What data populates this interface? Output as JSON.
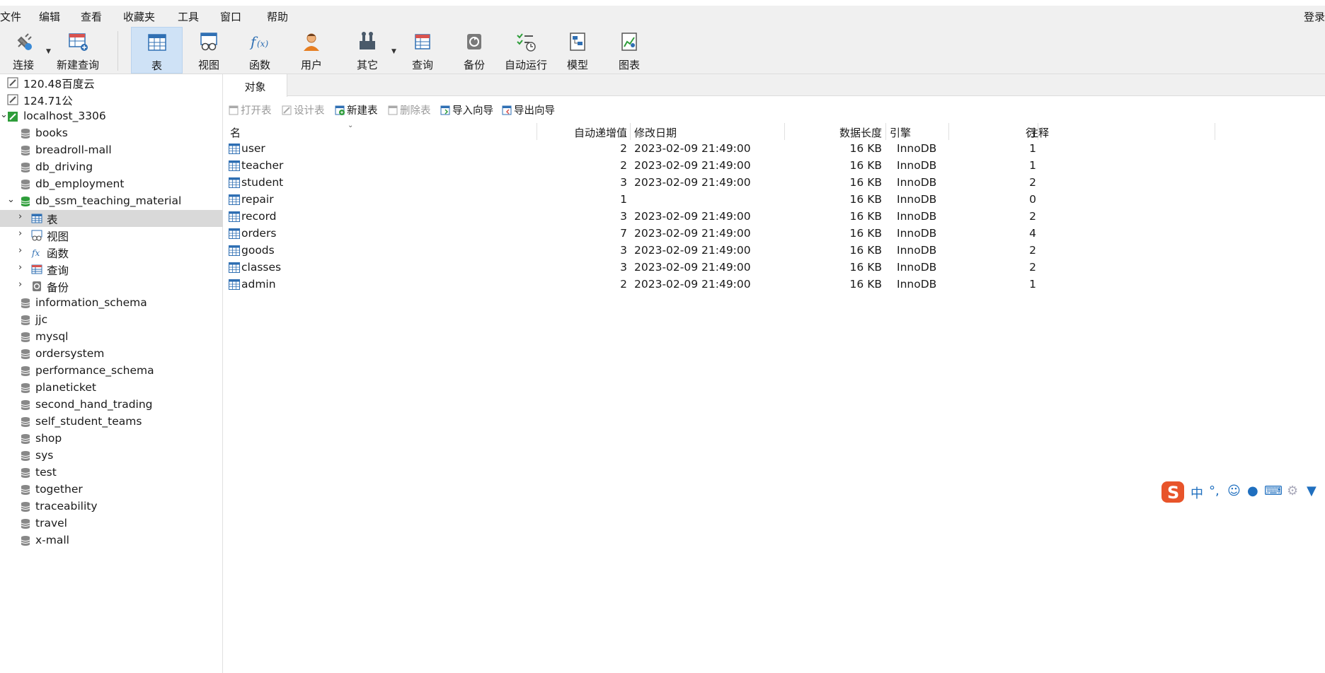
{
  "menu": {
    "items": [
      "文件",
      "编辑",
      "查看",
      "收藏夹",
      "工具",
      "窗口",
      "帮助"
    ],
    "login": "登录"
  },
  "toolbar": {
    "connect": "连接",
    "new_query": "新建查询",
    "table": "表",
    "view": "视图",
    "function": "函数",
    "user": "用户",
    "other": "其它",
    "query": "查询",
    "backup": "备份",
    "automation": "自动运行",
    "model": "模型",
    "chart": "图表"
  },
  "sidebar": {
    "connections": [
      "120.48百度云",
      "124.71公",
      "localhost_3306"
    ],
    "databases_before": [
      "books",
      "breadroll-mall",
      "db_driving",
      "db_employment",
      "db_ssm_teaching_material"
    ],
    "open_db_children": [
      "表",
      "视图",
      "函数",
      "查询",
      "备份"
    ],
    "databases_after": [
      "information_schema",
      "jjc",
      "mysql",
      "ordersystem",
      "performance_schema",
      "planeticket",
      "second_hand_trading",
      "self_student_teams",
      "shop",
      "sys",
      "test",
      "together",
      "traceability",
      "travel",
      "x-mall"
    ]
  },
  "main": {
    "tab": "对象",
    "object_toolbar": {
      "open_table": "打开表",
      "design_table": "设计表",
      "new_table": "新建表",
      "delete_table": "删除表",
      "import_wizard": "导入向导",
      "export_wizard": "导出向导"
    },
    "columns": [
      "名",
      "自动递增值",
      "修改日期",
      "数据长度",
      "引擎",
      "行",
      "注释"
    ],
    "rows": [
      {
        "name": "user",
        "auto_inc": "2",
        "modified": "2023-02-09 21:49:00",
        "size": "16 KB",
        "engine": "InnoDB",
        "rows": "1"
      },
      {
        "name": "teacher",
        "auto_inc": "2",
        "modified": "2023-02-09 21:49:00",
        "size": "16 KB",
        "engine": "InnoDB",
        "rows": "1"
      },
      {
        "name": "student",
        "auto_inc": "3",
        "modified": "2023-02-09 21:49:00",
        "size": "16 KB",
        "engine": "InnoDB",
        "rows": "2"
      },
      {
        "name": "repair",
        "auto_inc": "1",
        "modified": "",
        "size": "16 KB",
        "engine": "InnoDB",
        "rows": "0"
      },
      {
        "name": "record",
        "auto_inc": "3",
        "modified": "2023-02-09 21:49:00",
        "size": "16 KB",
        "engine": "InnoDB",
        "rows": "2"
      },
      {
        "name": "orders",
        "auto_inc": "7",
        "modified": "2023-02-09 21:49:00",
        "size": "16 KB",
        "engine": "InnoDB",
        "rows": "4"
      },
      {
        "name": "goods",
        "auto_inc": "3",
        "modified": "2023-02-09 21:49:00",
        "size": "16 KB",
        "engine": "InnoDB",
        "rows": "2"
      },
      {
        "name": "classes",
        "auto_inc": "3",
        "modified": "2023-02-09 21:49:00",
        "size": "16 KB",
        "engine": "InnoDB",
        "rows": "2"
      },
      {
        "name": "admin",
        "auto_inc": "2",
        "modified": "2023-02-09 21:49:00",
        "size": "16 KB",
        "engine": "InnoDB",
        "rows": "1"
      }
    ]
  },
  "ime": {
    "mode": "中",
    "punct": "°,"
  },
  "colors": {
    "accent": "#cfe2f6",
    "selected_row": "#d9d9d9",
    "toolbar_bg": "#f0f0f0",
    "db_green": "#2e9d3a",
    "icon_blue": "#2f6fb3"
  }
}
